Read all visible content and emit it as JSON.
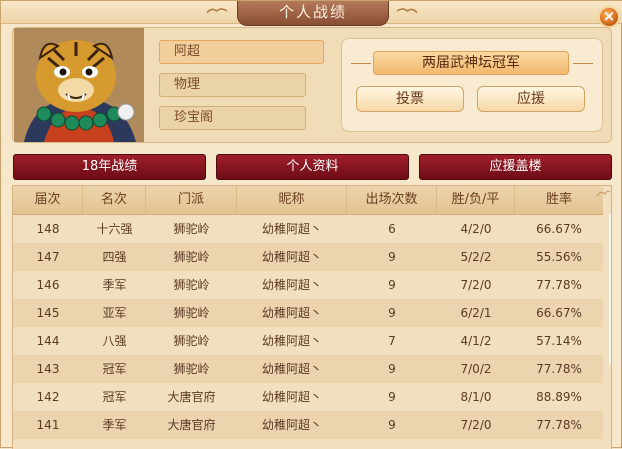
{
  "window": {
    "title": "个人战绩"
  },
  "profile": {
    "name": "阿超",
    "sect_type": "物理",
    "location": "珍宝阁"
  },
  "honor": {
    "title": "两届武神坛冠军",
    "vote_label": "投票",
    "support_label": "应援"
  },
  "tabs": [
    {
      "label": "18年战绩"
    },
    {
      "label": "个人资料"
    },
    {
      "label": "应援盖楼"
    }
  ],
  "table": {
    "headers": [
      "届次",
      "名次",
      "门派",
      "昵称",
      "出场次数",
      "胜/负/平",
      "胜率"
    ],
    "rows": [
      [
        "148",
        "十六强",
        "狮驼岭",
        "幼稚阿超丶",
        "6",
        "4/2/0",
        "66.67%"
      ],
      [
        "147",
        "四强",
        "狮驼岭",
        "幼稚阿超丶",
        "9",
        "5/2/2",
        "55.56%"
      ],
      [
        "146",
        "季军",
        "狮驼岭",
        "幼稚阿超丶",
        "9",
        "7/2/0",
        "77.78%"
      ],
      [
        "145",
        "亚军",
        "狮驼岭",
        "幼稚阿超丶",
        "9",
        "6/2/1",
        "66.67%"
      ],
      [
        "144",
        "八强",
        "狮驼岭",
        "幼稚阿超丶",
        "7",
        "4/1/2",
        "57.14%"
      ],
      [
        "143",
        "冠军",
        "狮驼岭",
        "幼稚阿超丶",
        "9",
        "7/0/2",
        "77.78%"
      ],
      [
        "142",
        "冠军",
        "大唐官府",
        "幼稚阿超丶",
        "9",
        "8/1/0",
        "88.89%"
      ],
      [
        "141",
        "季军",
        "大唐官府",
        "幼稚阿超丶",
        "9",
        "7/2/0",
        "77.78%"
      ]
    ]
  },
  "colors": {
    "accent_red": "#8a1520",
    "panel_bg": "#f6e7cb",
    "text_brown": "#5b3a24"
  }
}
